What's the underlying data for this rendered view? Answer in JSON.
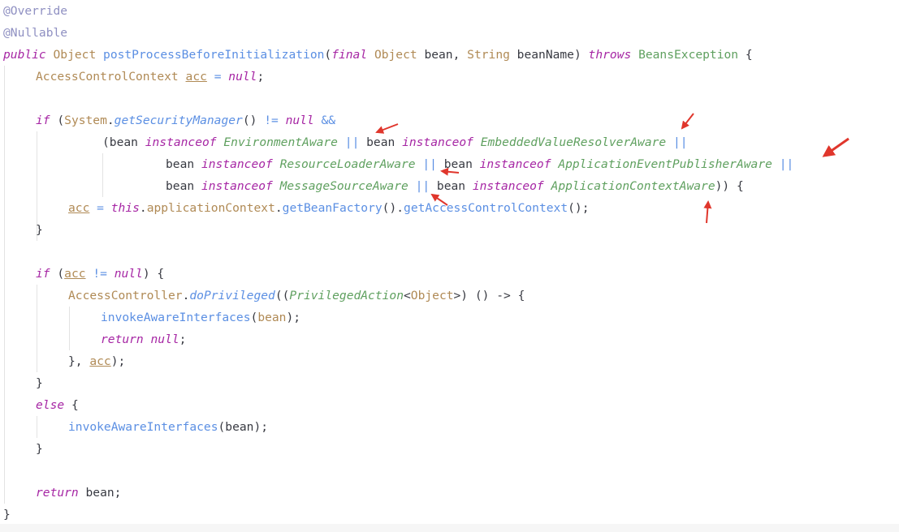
{
  "colors": {
    "keyword": "#a626a4",
    "type": "#b08a55",
    "class": "#5fa05f",
    "method": "#5b8fe3",
    "annotation": "#8f90c2",
    "default": "#383a42",
    "arrow": "#e0362c",
    "guide": "#e3e3e3"
  },
  "lines": [
    [
      {
        "t": "@Override",
        "c": "annotation"
      }
    ],
    [
      {
        "t": "@Nullable",
        "c": "annotation"
      }
    ],
    [
      {
        "t": "public",
        "c": "keyword",
        "i": true
      },
      {
        "t": " "
      },
      {
        "t": "Object",
        "c": "type"
      },
      {
        "t": " "
      },
      {
        "t": "postProcessBeforeInitialization",
        "c": "method"
      },
      {
        "t": "("
      },
      {
        "t": "final",
        "c": "keyword",
        "i": true
      },
      {
        "t": " "
      },
      {
        "t": "Object",
        "c": "type"
      },
      {
        "t": " bean, "
      },
      {
        "t": "String",
        "c": "type"
      },
      {
        "t": " beanName) "
      },
      {
        "t": "throws",
        "c": "keyword",
        "i": true
      },
      {
        "t": " "
      },
      {
        "t": "BeansException",
        "c": "class"
      },
      {
        "t": " {"
      }
    ],
    [
      {
        "t": "AccessControlContext",
        "c": "type"
      },
      {
        "t": " "
      },
      {
        "t": "acc",
        "c": "type",
        "u": true
      },
      {
        "t": " "
      },
      {
        "t": "=",
        "c": "method"
      },
      {
        "t": " "
      },
      {
        "t": "null",
        "c": "keyword",
        "i": true
      },
      {
        "t": ";"
      }
    ],
    [],
    [
      {
        "t": "if",
        "c": "keyword",
        "i": true
      },
      {
        "t": " ("
      },
      {
        "t": "System",
        "c": "type"
      },
      {
        "t": "."
      },
      {
        "t": "getSecurityManager",
        "c": "method",
        "i": true
      },
      {
        "t": "() "
      },
      {
        "t": "!=",
        "c": "method"
      },
      {
        "t": " "
      },
      {
        "t": "null",
        "c": "keyword",
        "i": true
      },
      {
        "t": " "
      },
      {
        "t": "&&",
        "c": "method"
      }
    ],
    [
      {
        "t": "(bean "
      },
      {
        "t": "instanceof",
        "c": "keyword",
        "i": true
      },
      {
        "t": " "
      },
      {
        "t": "EnvironmentAware",
        "c": "class",
        "i": true
      },
      {
        "t": " "
      },
      {
        "t": "||",
        "c": "method"
      },
      {
        "t": " bean "
      },
      {
        "t": "instanceof",
        "c": "keyword",
        "i": true
      },
      {
        "t": " "
      },
      {
        "t": "EmbeddedValueResolverAware",
        "c": "class",
        "i": true
      },
      {
        "t": " "
      },
      {
        "t": "||",
        "c": "method"
      }
    ],
    [
      {
        "t": "bean "
      },
      {
        "t": "instanceof",
        "c": "keyword",
        "i": true
      },
      {
        "t": " "
      },
      {
        "t": "ResourceLoaderAware",
        "c": "class",
        "i": true
      },
      {
        "t": " "
      },
      {
        "t": "||",
        "c": "method"
      },
      {
        "t": " bean "
      },
      {
        "t": "instanceof",
        "c": "keyword",
        "i": true
      },
      {
        "t": " "
      },
      {
        "t": "ApplicationEventPublisherAware",
        "c": "class",
        "i": true
      },
      {
        "t": " "
      },
      {
        "t": "||",
        "c": "method"
      }
    ],
    [
      {
        "t": "bean "
      },
      {
        "t": "instanceof",
        "c": "keyword",
        "i": true
      },
      {
        "t": " "
      },
      {
        "t": "MessageSourceAware",
        "c": "class",
        "i": true
      },
      {
        "t": " "
      },
      {
        "t": "||",
        "c": "method"
      },
      {
        "t": " bean "
      },
      {
        "t": "instanceof",
        "c": "keyword",
        "i": true
      },
      {
        "t": " "
      },
      {
        "t": "ApplicationContextAware",
        "c": "class",
        "i": true
      },
      {
        "t": ")) {"
      }
    ],
    [
      {
        "t": "acc",
        "c": "type",
        "u": true
      },
      {
        "t": " "
      },
      {
        "t": "=",
        "c": "method"
      },
      {
        "t": " "
      },
      {
        "t": "this",
        "c": "keyword",
        "i": true
      },
      {
        "t": "."
      },
      {
        "t": "applicationContext",
        "c": "type"
      },
      {
        "t": "."
      },
      {
        "t": "getBeanFactory",
        "c": "method"
      },
      {
        "t": "()."
      },
      {
        "t": "getAccessControlContext",
        "c": "method"
      },
      {
        "t": "();"
      }
    ],
    [
      {
        "t": "}"
      }
    ],
    [],
    [
      {
        "t": "if",
        "c": "keyword",
        "i": true
      },
      {
        "t": " ("
      },
      {
        "t": "acc",
        "c": "type",
        "u": true
      },
      {
        "t": " "
      },
      {
        "t": "!=",
        "c": "method"
      },
      {
        "t": " "
      },
      {
        "t": "null",
        "c": "keyword",
        "i": true
      },
      {
        "t": ") {"
      }
    ],
    [
      {
        "t": "AccessController",
        "c": "type"
      },
      {
        "t": "."
      },
      {
        "t": "doPrivileged",
        "c": "method",
        "i": true
      },
      {
        "t": "(("
      },
      {
        "t": "PrivilegedAction",
        "c": "class",
        "i": true
      },
      {
        "t": "<"
      },
      {
        "t": "Object",
        "c": "type"
      },
      {
        "t": ">) () -> {"
      }
    ],
    [
      {
        "t": "invokeAwareInterfaces",
        "c": "method"
      },
      {
        "t": "("
      },
      {
        "t": "bean",
        "c": "type"
      },
      {
        "t": ");"
      }
    ],
    [
      {
        "t": "return",
        "c": "keyword",
        "i": true
      },
      {
        "t": " "
      },
      {
        "t": "null",
        "c": "keyword",
        "i": true
      },
      {
        "t": ";"
      }
    ],
    [
      {
        "t": "}, "
      },
      {
        "t": "acc",
        "c": "type",
        "u": true
      },
      {
        "t": ");"
      }
    ],
    [
      {
        "t": "}"
      }
    ],
    [
      {
        "t": "else",
        "c": "keyword",
        "i": true
      },
      {
        "t": " {"
      }
    ],
    [
      {
        "t": "invokeAwareInterfaces",
        "c": "method"
      },
      {
        "t": "(bean);"
      }
    ],
    [
      {
        "t": "}"
      }
    ],
    [],
    [
      {
        "t": "return",
        "c": "keyword",
        "i": true
      },
      {
        "t": " bean;"
      }
    ],
    [
      {
        "t": "}"
      }
    ]
  ]
}
